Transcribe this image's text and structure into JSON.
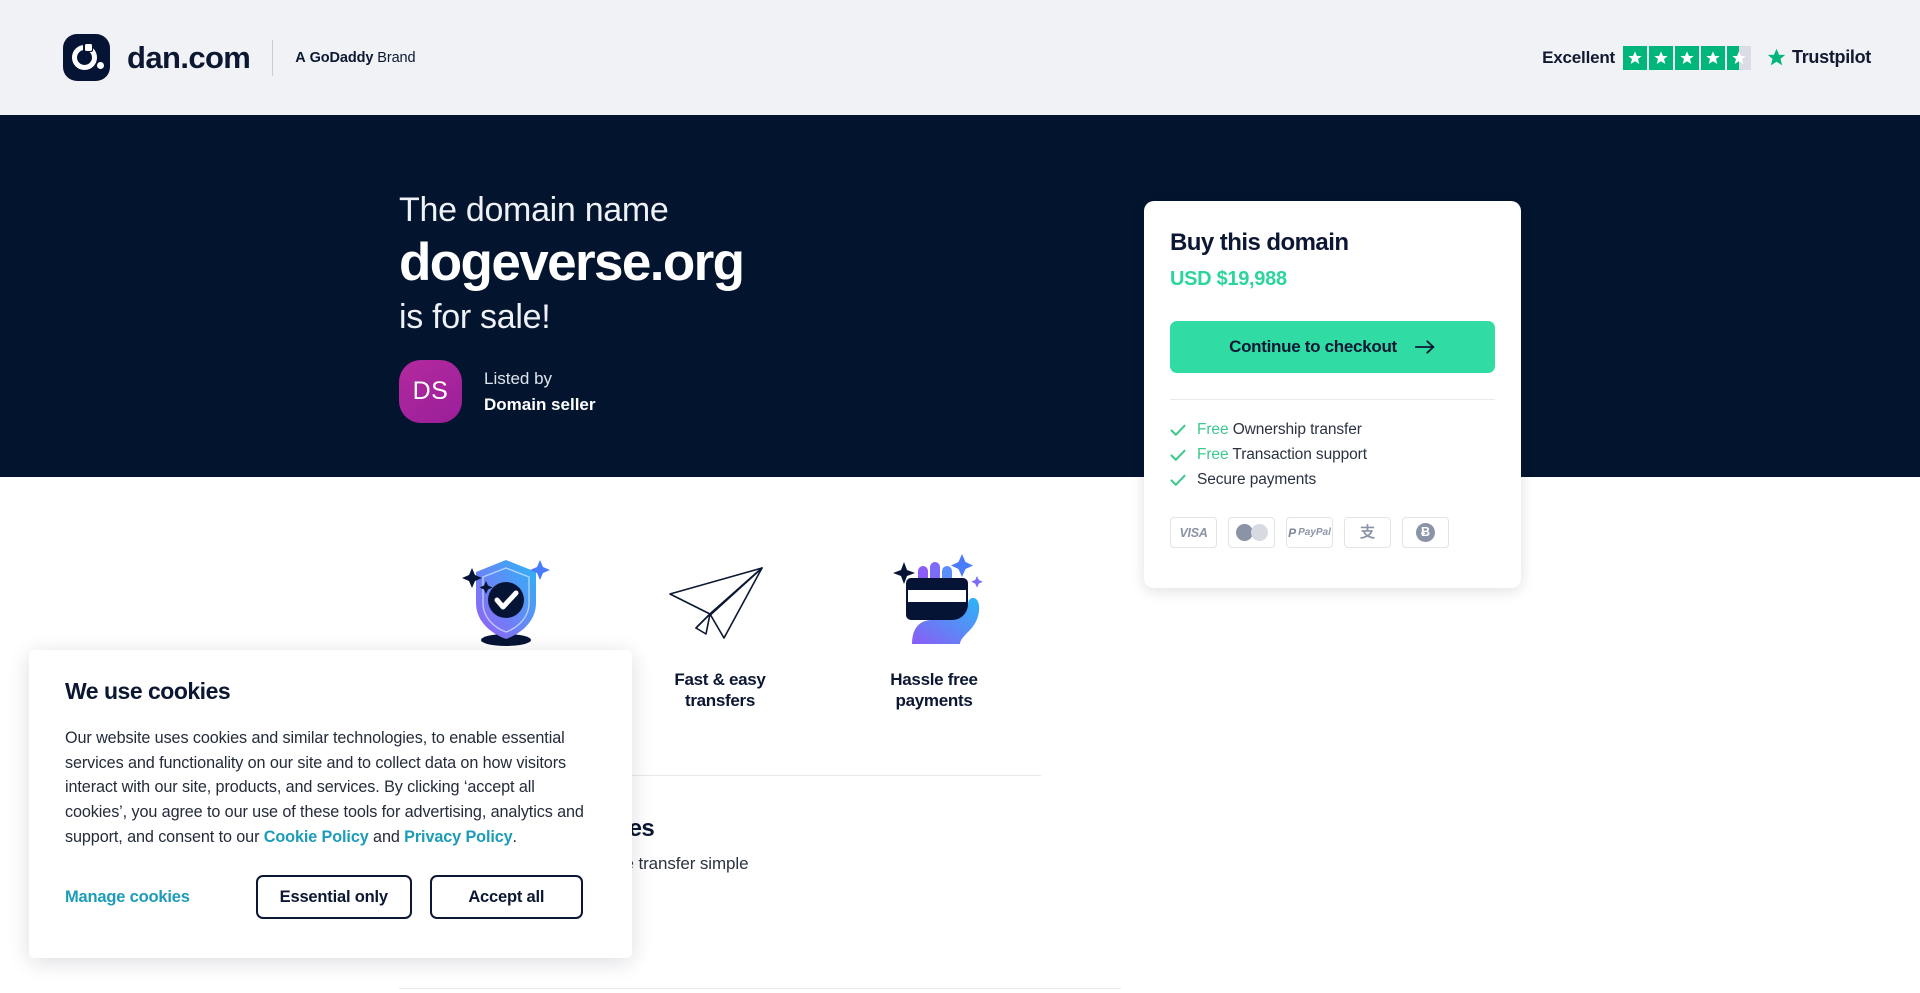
{
  "header": {
    "brand_name": "dan.com",
    "tagline_a": "A",
    "tagline_brand": "GoDaddy",
    "tagline_word": "Brand",
    "logo_icon": "dan-logo-icon"
  },
  "trustpilot": {
    "rating_word": "Excellent",
    "name": "Trustpilot",
    "stars_full": 4,
    "stars_half": 1,
    "star_color": "#00b67a",
    "star_empty_color": "#dcdce6"
  },
  "hero": {
    "line1": "The domain name",
    "domain": "dogeverse.org",
    "line3": "is for sale!",
    "background": "#03142e",
    "seller": {
      "initials": "DS",
      "listed_by_label": "Listed by",
      "name": "Domain seller",
      "avatar_color": "#a3239d"
    }
  },
  "buy_card": {
    "title": "Buy this domain",
    "price": "USD $19,988",
    "price_color": "#2bd59b",
    "cta_label": "Continue to checkout",
    "cta_color": "#31dca4",
    "cta_icon": "arrow-right-icon",
    "benefits": [
      {
        "highlight": "Free",
        "text": " Ownership transfer"
      },
      {
        "highlight": "Free",
        "text": " Transaction support"
      },
      {
        "highlight": "",
        "text": "Secure payments"
      }
    ],
    "payment_methods": [
      {
        "name": "visa",
        "label": "VISA"
      },
      {
        "name": "mastercard",
        "label": ""
      },
      {
        "name": "paypal",
        "label1": "P",
        "label2": "PayPal"
      },
      {
        "name": "alipay",
        "label": "支"
      },
      {
        "name": "bitcoin",
        "label": "Ƀ"
      }
    ]
  },
  "features": [
    {
      "icon": "shield-check-icon",
      "label": ""
    },
    {
      "icon": "paper-plane-icon",
      "label": "Fast & easy\ntransfers"
    },
    {
      "icon": "card-hand-icon",
      "label": "Hassle free\npayments"
    }
  ],
  "lower_section": {
    "title": "y to buy domain names",
    "subtitle": "n you want to buy, we make the transfer simple"
  },
  "cookie_banner": {
    "title": "We use cookies",
    "body_part1": "Our website uses cookies and similar technologies, to enable essential services and functionality on our site and to collect data on how visitors interact with our site, products, and services. By clicking ‘accept all cookies’, you agree to our use of these tools for advertising, analytics and support, and consent to our ",
    "link_cookie": "Cookie Policy",
    "body_part2": " and ",
    "link_privacy": "Privacy Policy",
    "body_part3": ".",
    "manage_label": "Manage cookies",
    "essential_label": "Essential only",
    "accept_label": "Accept all",
    "link_color": "#1c9cb8"
  }
}
